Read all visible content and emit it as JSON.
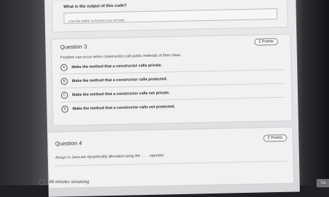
{
  "previous_question": {
    "prompt": "What is the output of this code?",
    "answer_placeholder": "Use the editor to format your answer"
  },
  "question3": {
    "title": "Question 3",
    "points": "2 Points",
    "text": "Problem can occur when constructors call public methods of their class.",
    "options": [
      {
        "letter": "A",
        "text": "Make the method that a constructor calls private."
      },
      {
        "letter": "B",
        "text": "Make the method that a constructor calls protected."
      },
      {
        "letter": "C",
        "text": "Make the method that a constructor calls not private."
      },
      {
        "letter": "D",
        "text": "Make the method that a constructor calls not protected."
      }
    ]
  },
  "question4": {
    "title": "Question 4",
    "points": "2 Points",
    "text": "Arrays in Java are dynamically allocated using the . . . . operator."
  },
  "footer": {
    "time_remaining": "86 minutes remaining",
    "save_label": "Sa"
  }
}
